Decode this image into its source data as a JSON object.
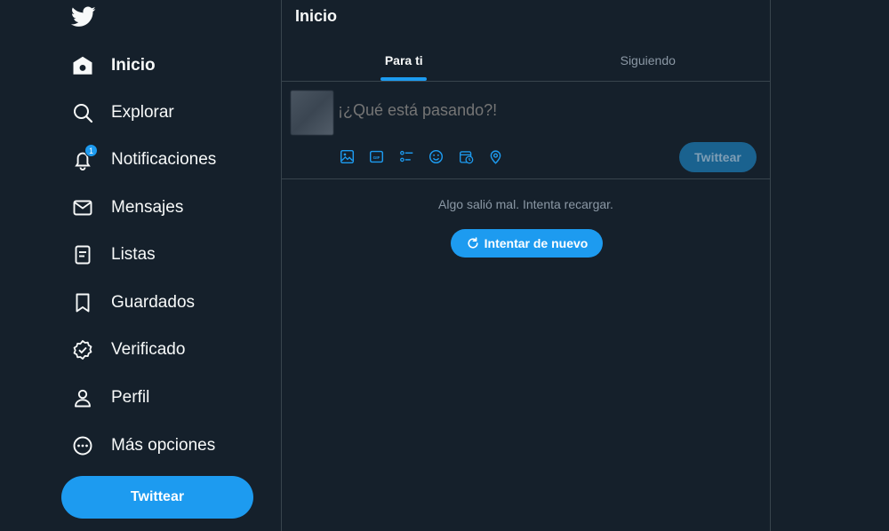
{
  "sidebar": {
    "logo_icon": "twitter-bird-icon",
    "items": [
      {
        "label": "Inicio",
        "icon": "home-icon",
        "active": true
      },
      {
        "label": "Explorar",
        "icon": "search-icon"
      },
      {
        "label": "Notificaciones",
        "icon": "bell-icon",
        "badge": "1"
      },
      {
        "label": "Mensajes",
        "icon": "envelope-icon"
      },
      {
        "label": "Listas",
        "icon": "list-icon"
      },
      {
        "label": "Guardados",
        "icon": "bookmark-icon"
      },
      {
        "label": "Verificado",
        "icon": "verified-icon"
      },
      {
        "label": "Perfil",
        "icon": "person-icon"
      },
      {
        "label": "Más opciones",
        "icon": "more-circle-icon"
      }
    ],
    "tweet_button": "Twittear"
  },
  "main": {
    "title": "Inicio",
    "tabs": [
      {
        "label": "Para ti",
        "active": true
      },
      {
        "label": "Siguiendo"
      }
    ],
    "composer": {
      "placeholder": "¡¿Qué está pasando?!",
      "tools": [
        "image-icon",
        "gif-icon",
        "poll-icon",
        "emoji-icon",
        "schedule-icon",
        "location-icon"
      ],
      "tweet_button": "Twittear"
    },
    "error": {
      "message": "Algo salió mal. Intenta recargar.",
      "retry_label": "Intentar de nuevo"
    }
  },
  "colors": {
    "background": "#15202b",
    "accent": "#1d9bf0",
    "border": "#38444d",
    "muted_text": "#8b98a5"
  }
}
